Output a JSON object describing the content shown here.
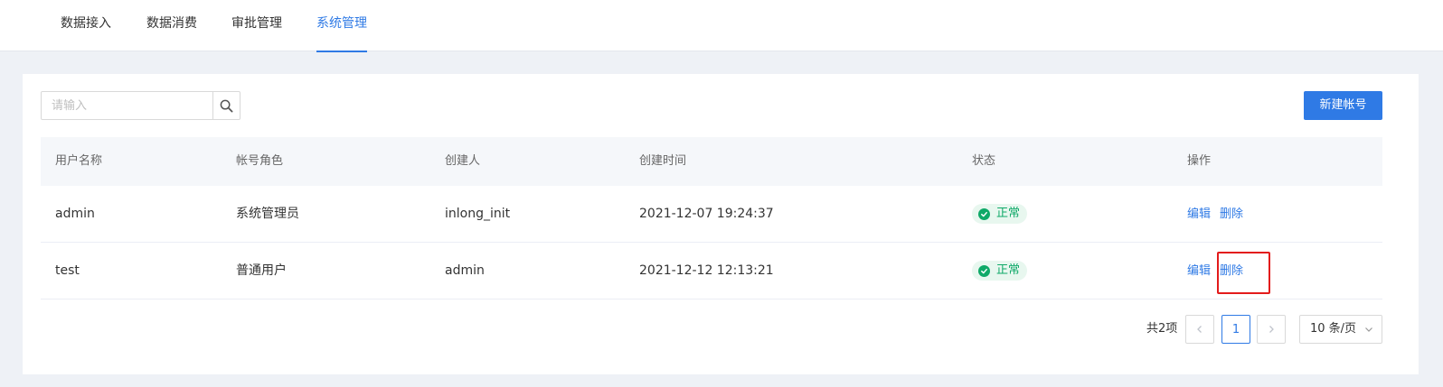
{
  "nav": {
    "items": [
      {
        "label": "数据接入",
        "active": false
      },
      {
        "label": "数据消费",
        "active": false
      },
      {
        "label": "审批管理",
        "active": false
      },
      {
        "label": "系统管理",
        "active": true
      }
    ]
  },
  "search": {
    "placeholder": "请输入",
    "value": "",
    "icon": "search-icon"
  },
  "actions": {
    "new_account_label": "新建帐号"
  },
  "table": {
    "columns": [
      "用户名称",
      "帐号角色",
      "创建人",
      "创建时间",
      "状态",
      "操作"
    ],
    "rows": [
      {
        "username": "admin",
        "role": "系统管理员",
        "creator": "inlong_init",
        "created_at": "2021-12-07 19:24:37",
        "status": "正常",
        "edit": "编辑",
        "delete": "删除"
      },
      {
        "username": "test",
        "role": "普通用户",
        "creator": "admin",
        "created_at": "2021-12-12 12:13:21",
        "status": "正常",
        "edit": "编辑",
        "delete": "删除"
      }
    ]
  },
  "pagination": {
    "total_text": "共2项",
    "current_page": "1",
    "prev_icon": "chevron-left-icon",
    "next_icon": "chevron-right-icon",
    "page_size": "10 条/页"
  },
  "colors": {
    "accent": "#2f7ae5",
    "success": "#0fa968",
    "success_bg": "#e8f7ef",
    "highlight": "#e31b1b"
  }
}
